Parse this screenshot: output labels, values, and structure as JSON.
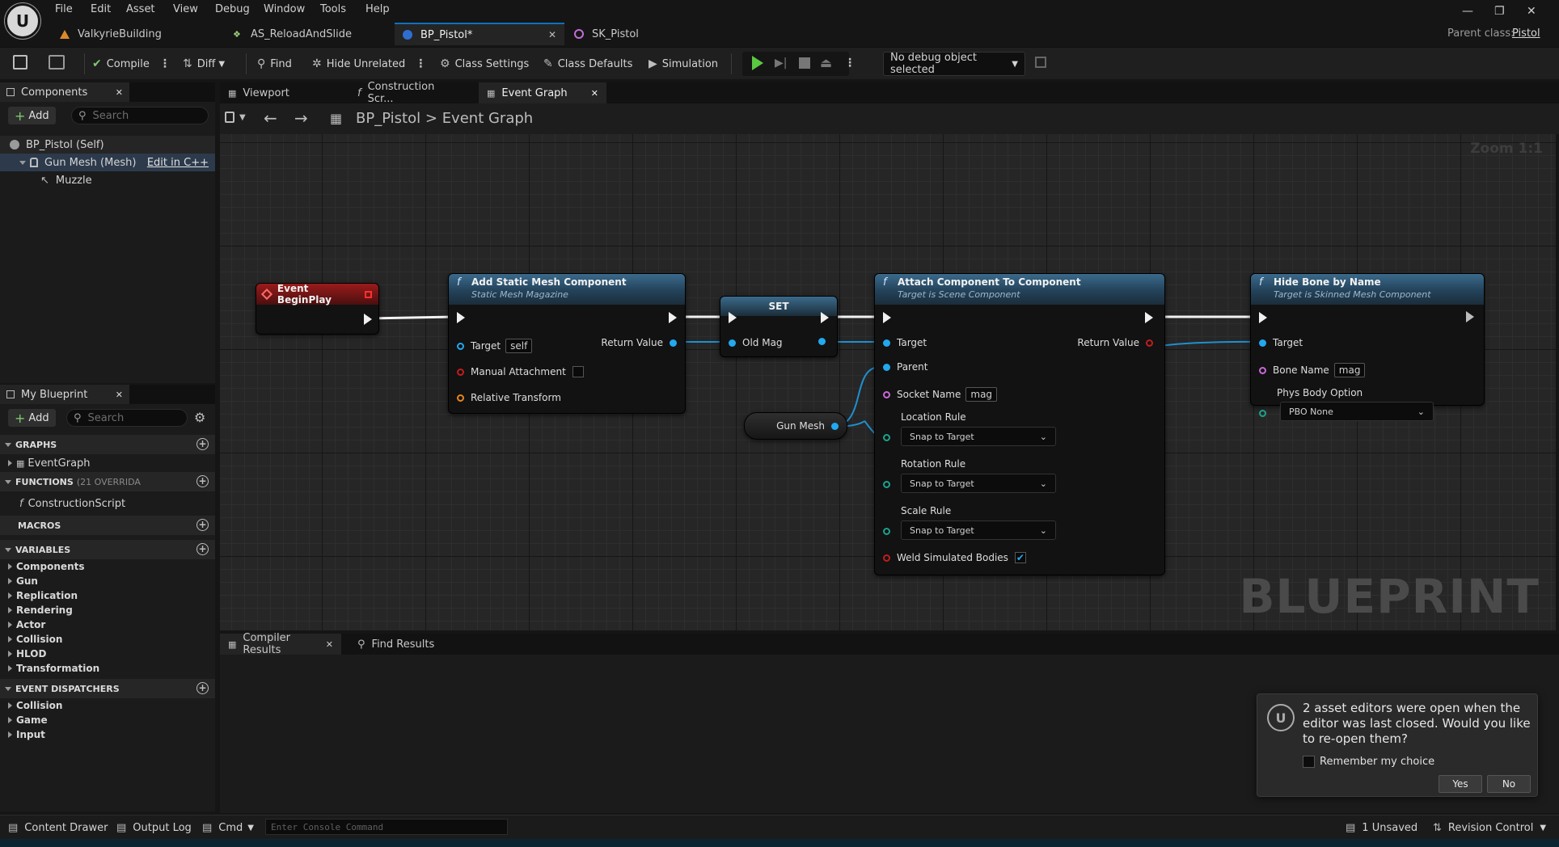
{
  "menu": [
    "File",
    "Edit",
    "Asset",
    "View",
    "Debug",
    "Window",
    "Tools",
    "Help"
  ],
  "doc_tabs": [
    {
      "label": "ValkyrieBuilding"
    },
    {
      "label": "AS_ReloadAndSlide"
    },
    {
      "label": "BP_Pistol*"
    },
    {
      "label": "SK_Pistol"
    }
  ],
  "parent_class": {
    "label": "Parent class:",
    "value": "Pistol"
  },
  "toolbar": {
    "compile": "Compile",
    "diff": "Diff",
    "find": "Find",
    "hide_unrelated": "Hide Unrelated",
    "class_settings": "Class Settings",
    "class_defaults": "Class Defaults",
    "simulation": "Simulation",
    "debug_object": "No debug object selected"
  },
  "components_panel": {
    "tab": "Components",
    "add": "Add",
    "search_placeholder": "Search",
    "items": [
      {
        "label": "BP_Pistol (Self)"
      },
      {
        "label": "Gun Mesh (Mesh)",
        "action": "Edit in C++"
      },
      {
        "label": "Muzzle"
      }
    ]
  },
  "my_blueprint": {
    "tab": "My Blueprint",
    "add": "Add",
    "search_placeholder": "Search",
    "graphs": {
      "header": "GRAPHS",
      "items": [
        "EventGraph"
      ]
    },
    "functions": {
      "header": "FUNCTIONS",
      "sub": "(21 OVERRIDA",
      "items": [
        "ConstructionScript"
      ]
    },
    "macros": {
      "header": "MACROS"
    },
    "variables": {
      "header": "VARIABLES",
      "items": [
        "Components",
        "Gun",
        "Replication",
        "Rendering",
        "Actor",
        "Collision",
        "HLOD",
        "Transformation"
      ]
    },
    "dispatchers": {
      "header": "EVENT DISPATCHERS",
      "items": [
        "Collision",
        "Game",
        "Input"
      ]
    }
  },
  "graph_tabs": [
    "Viewport",
    "Construction Scr...",
    "Event Graph"
  ],
  "breadcrumb": {
    "root": "BP_Pistol",
    "sep": ">",
    "current": "Event Graph"
  },
  "zoom": "Zoom 1:1",
  "watermark": "BLUEPRINT",
  "nodes": {
    "begin_play": {
      "title": "Event BeginPlay"
    },
    "add_static_mesh": {
      "title": "Add Static Mesh Component",
      "subtitle": "Static Mesh Magazine",
      "target_label": "Target",
      "target_value": "self",
      "manual_attachment": "Manual Attachment",
      "relative_transform": "Relative Transform",
      "return_value": "Return Value"
    },
    "set": {
      "title": "SET",
      "var": "Old Mag"
    },
    "gun_mesh": {
      "label": "Gun Mesh"
    },
    "attach": {
      "title": "Attach Component To Component",
      "subtitle": "Target is Scene Component",
      "target": "Target",
      "parent": "Parent",
      "return_value": "Return Value",
      "socket_name": "Socket Name",
      "socket_value": "mag",
      "location_rule": "Location Rule",
      "location_value": "Snap to Target",
      "rotation_rule": "Rotation Rule",
      "rotation_value": "Snap to Target",
      "scale_rule": "Scale Rule",
      "scale_value": "Snap to Target",
      "weld": "Weld Simulated Bodies"
    },
    "hide_bone": {
      "title": "Hide Bone by Name",
      "subtitle": "Target is Skinned Mesh Component",
      "target": "Target",
      "bone_name": "Bone Name",
      "bone_value": "mag",
      "phys_option": "Phys Body Option",
      "phys_value": "PBO None"
    }
  },
  "results_tabs": [
    "Compiler Results",
    "Find Results"
  ],
  "notification": {
    "message": "2 asset editors were open when the editor was last closed. Would you like to re-open them?",
    "remember": "Remember my choice",
    "yes": "Yes",
    "no": "No"
  },
  "statusbar": {
    "content_drawer": "Content Drawer",
    "output_log": "Output Log",
    "cmd": "Cmd",
    "console_placeholder": "Enter Console Command",
    "unsaved": "1 Unsaved",
    "revision_control": "Revision Control"
  },
  "colors": {
    "accent": "#0e70c0",
    "pin_object": "#22a9ef",
    "event_header": "#9a1b1b",
    "function_header": "#3b6a8b"
  }
}
